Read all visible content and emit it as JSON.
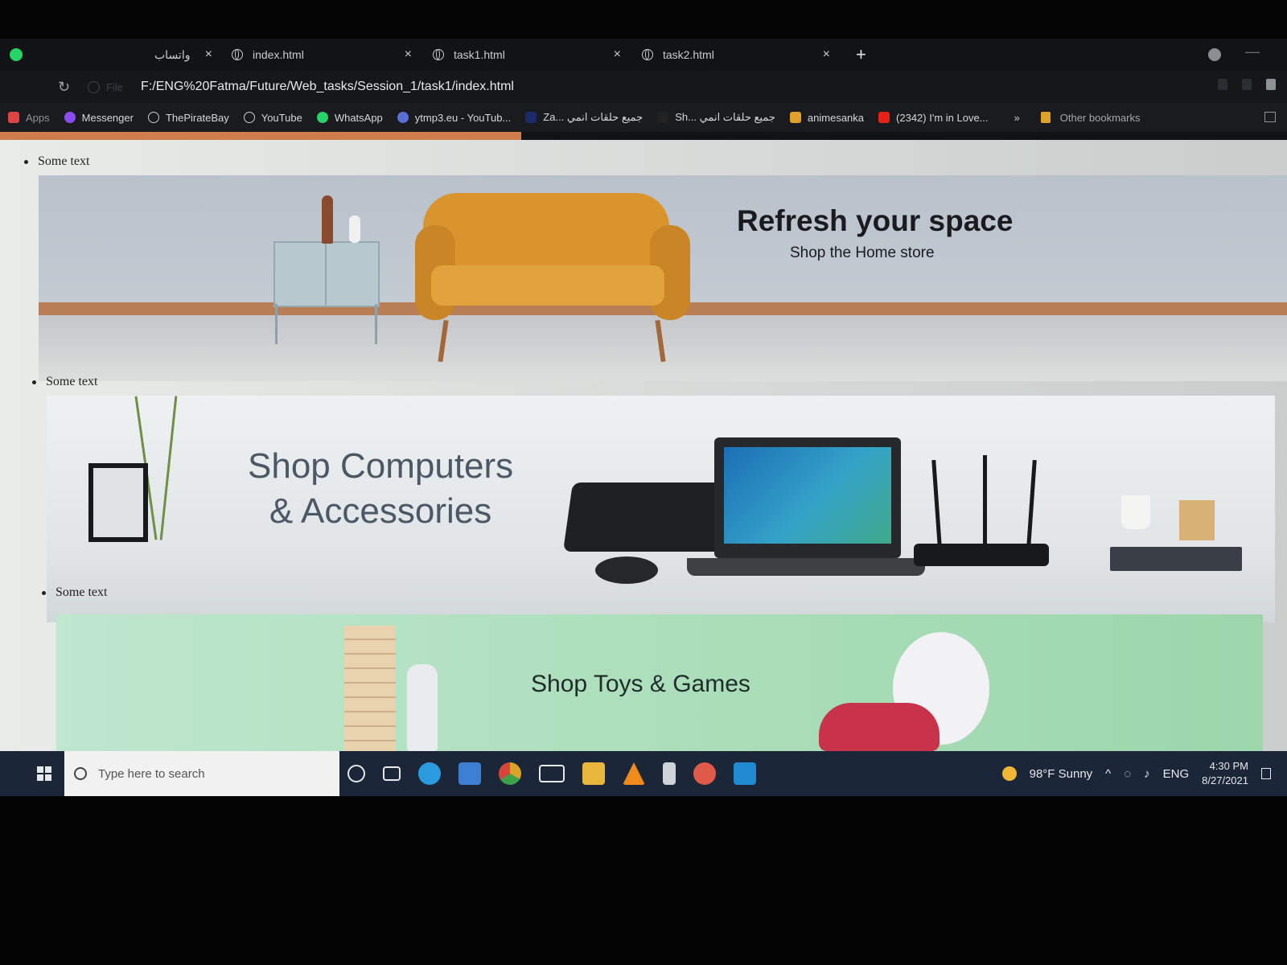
{
  "browser": {
    "tabs": [
      {
        "label": "واتساب",
        "icon": "whatsapp-icon"
      },
      {
        "label": "index.html",
        "icon": "globe-icon"
      },
      {
        "label": "task1.html",
        "icon": "globe-icon"
      },
      {
        "label": "task2.html",
        "icon": "globe-icon"
      }
    ],
    "new_tab_label": "+",
    "tab_close_label": "×",
    "address": {
      "file_label": "File",
      "url": "F:/ENG%20Fatma/Future/Web_tasks/Session_1/task1/index.html"
    },
    "bookmarks": [
      {
        "label": "Apps",
        "icon": "apps-grid-icon",
        "color": "#d44"
      },
      {
        "label": "Messenger",
        "icon": "messenger-icon",
        "color": "#8a4df3"
      },
      {
        "label": "ThePirateBay",
        "icon": "globe-icon",
        "color": "#c9ccd1"
      },
      {
        "label": "YouTube",
        "icon": "globe-icon",
        "color": "#c9ccd1"
      },
      {
        "label": "WhatsApp",
        "icon": "whatsapp-icon",
        "color": "#25d366"
      },
      {
        "label": "ytmp3.eu - YouTub...",
        "icon": "ytmp3-icon",
        "color": "#5a6fd6"
      },
      {
        "label": "Za... جميع حلقات انمي",
        "icon": "anime-icon",
        "color": "#1b2a6b"
      },
      {
        "label": "Sh... جميع حلقات انمي",
        "icon": "anime-icon",
        "color": "#222"
      },
      {
        "label": "animesanka",
        "icon": "folder-icon",
        "color": "#e0a128"
      },
      {
        "label": "(2342) I'm in Love...",
        "icon": "youtube-icon",
        "color": "#e62117"
      }
    ],
    "overflow_label": "»",
    "other_bookmarks_label": "Other bookmarks"
  },
  "page": {
    "list_items": [
      {
        "text": "Some text"
      },
      {
        "text": "Some text"
      },
      {
        "text": "Some text"
      }
    ],
    "banners": [
      {
        "title": "Refresh your space",
        "subtitle": "Shop the Home store"
      },
      {
        "title_line1": "Shop Computers",
        "title_line2": "& Accessories"
      },
      {
        "title": "Shop Toys & Games"
      }
    ]
  },
  "taskbar": {
    "search_placeholder": "Type here to search",
    "pinned": [
      {
        "icon": "cortana-icon",
        "color": "#e6e8ea"
      },
      {
        "icon": "task-view-icon",
        "color": "#e6e8ea"
      },
      {
        "icon": "edge-icon",
        "color": "#2b9be0"
      },
      {
        "icon": "store-icon",
        "color": "#3d7fd4"
      },
      {
        "icon": "chrome-icon",
        "color": "#d9a32b"
      },
      {
        "icon": "mail-icon",
        "color": "#e6e8ea"
      },
      {
        "icon": "file-explorer-icon",
        "color": "#e9b63c"
      },
      {
        "icon": "vlc-icon",
        "color": "#f08a1c"
      },
      {
        "icon": "app-icon",
        "color": "#cfd2d6"
      },
      {
        "icon": "settings-app-icon",
        "color": "#e05a4a"
      },
      {
        "icon": "vscode-icon",
        "color": "#1f8ad2"
      }
    ],
    "weather": "98°F  Sunny",
    "language": "ENG",
    "time": "4:30 PM",
    "date": "8/27/2021"
  }
}
